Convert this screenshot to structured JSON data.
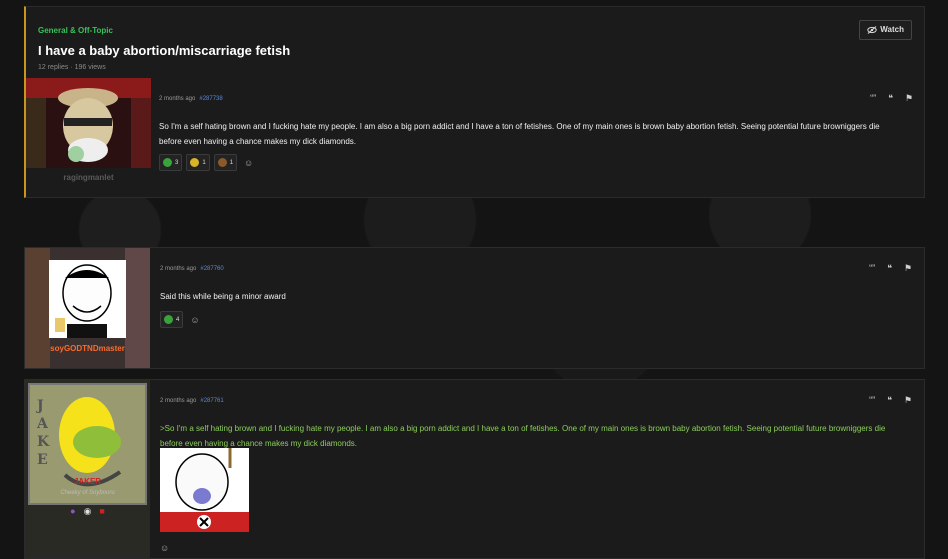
{
  "thread": {
    "category": "General & Off-Topic",
    "title": "I have a baby abortion/miscarriage fetish",
    "meta": "12 replies · 196 views",
    "watch_label": "Watch"
  },
  "posts": [
    {
      "username": "ragingmanlet",
      "time": "2 months ago",
      "id": "#287738",
      "text": "So I'm a self hating brown and I fucking hate my people. I am also a big porn addict and I have a ton of fetishes. One of my main ones is brown baby abortion fetish. Seeing potential future browniggers die before even having a chance makes my dick diamonds.",
      "reactions": [
        {
          "icon": "green-face",
          "count": "3",
          "color": "#3aa23a"
        },
        {
          "icon": "yellow-face",
          "count": "1",
          "color": "#d9b32a"
        },
        {
          "icon": "brown-face",
          "count": "1",
          "color": "#8a5a2a"
        }
      ]
    },
    {
      "username": "soyGODTNDmaster",
      "time": "2 months ago",
      "id": "#287760",
      "text": "Said this while being a minor award",
      "reactions": [
        {
          "icon": "green-face",
          "count": "4",
          "color": "#3aa23a"
        }
      ]
    },
    {
      "username": "JAKER",
      "usertitle": "Cheeky of Soybooru",
      "time": "2 months ago",
      "id": "#287761",
      "text": ">So I'm a self hating brown and I fucking hate my people. I am also a big porn addict and I have a ton of fetishes. One of my main ones is brown baby abortion fetish. Seeing potential future browniggers die before even having a chance makes my dick diamonds."
    }
  ],
  "icons": {
    "watch": "eye-slash-icon",
    "quote": "quote-icon",
    "multiquote": "multiquote-icon",
    "report": "flag-icon",
    "add_reaction": "smiley-icon"
  },
  "colors": {
    "category": "#39c05a",
    "post_id": "#5c88d6",
    "greentext": "#8bcf5a",
    "accent": "#c8961e"
  }
}
